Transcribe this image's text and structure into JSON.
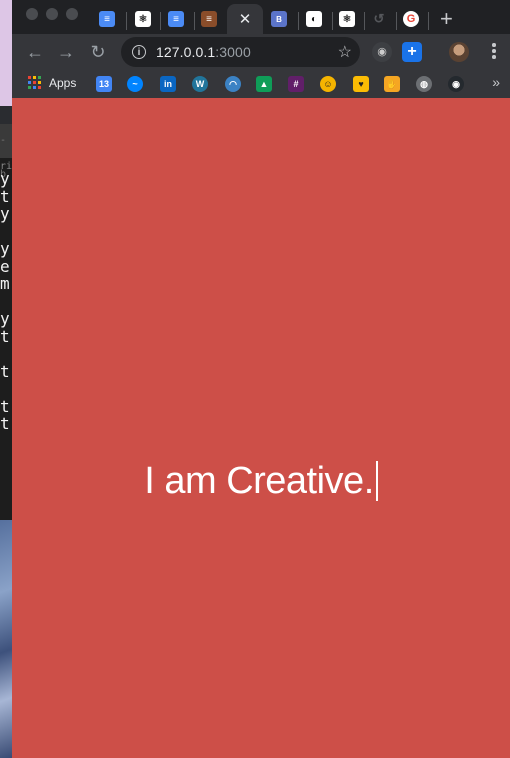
{
  "side_app": {
    "terminal_tab": "-b",
    "terminal_sub": "rit",
    "lines": [
      "y",
      "t",
      "y",
      "",
      "y",
      "e",
      "m",
      "",
      "y",
      "t",
      "",
      "t",
      "",
      "t",
      "t"
    ]
  },
  "browser": {
    "tabs": [
      {
        "icon": "docs-icon",
        "color": "#4b8bf5",
        "glyph": "≡"
      },
      {
        "icon": "react-dev-icon",
        "color": "#ffffff",
        "glyph": "⚛"
      },
      {
        "icon": "docs-icon",
        "color": "#4b8bf5",
        "glyph": "≡"
      },
      {
        "icon": "stack-overflow-icon",
        "color": "#f48024",
        "glyph": "≡"
      },
      {
        "icon": "close-icon",
        "active": true
      },
      {
        "icon": "bootstrap-icon",
        "color": "#5b74c9",
        "glyph": "B"
      },
      {
        "icon": "audio-icon",
        "color": "#ffffff",
        "glyph": "◐"
      },
      {
        "icon": "react-dev-icon",
        "color": "#ffffff",
        "glyph": "⚛"
      },
      {
        "icon": "blank-tab-icon",
        "color": "#55575b",
        "glyph": "↺"
      },
      {
        "icon": "google-icon",
        "color": "#ffffff",
        "glyph": "G"
      }
    ],
    "new_tab_symbol": "+",
    "address": {
      "host": "127.0.0.1",
      "port": ":3000"
    },
    "bookmarks": {
      "apps_label": "Apps",
      "items": [
        {
          "icon": "calendar-icon",
          "color": "#4285f4",
          "glyph": "13"
        },
        {
          "icon": "messenger-icon",
          "color": "#0084ff",
          "glyph": "~"
        },
        {
          "icon": "linkedin-icon",
          "color": "#0a66c2",
          "glyph": "in"
        },
        {
          "icon": "wordpress-icon",
          "color": "#21759b",
          "glyph": "W"
        },
        {
          "icon": "rainbow-icon",
          "color": "#3b82c4",
          "glyph": "◠"
        },
        {
          "icon": "drive-icon",
          "color": "#0f9d58",
          "glyph": "▲"
        },
        {
          "icon": "slack-icon",
          "color": "#611f69",
          "glyph": "#"
        },
        {
          "icon": "smiley-icon",
          "color": "#f5b400",
          "glyph": "☺"
        },
        {
          "icon": "keep-icon",
          "color": "#fbbc04",
          "glyph": "♥"
        },
        {
          "icon": "hand-icon",
          "color": "#f5a623",
          "glyph": "✋"
        },
        {
          "icon": "globe-icon",
          "color": "#6c6f73",
          "glyph": "◍"
        },
        {
          "icon": "github-icon",
          "color": "#24292e",
          "glyph": "◉"
        }
      ],
      "overflow": "»"
    },
    "content": {
      "background": "#cd4f48",
      "headline": "I am Creative."
    }
  }
}
